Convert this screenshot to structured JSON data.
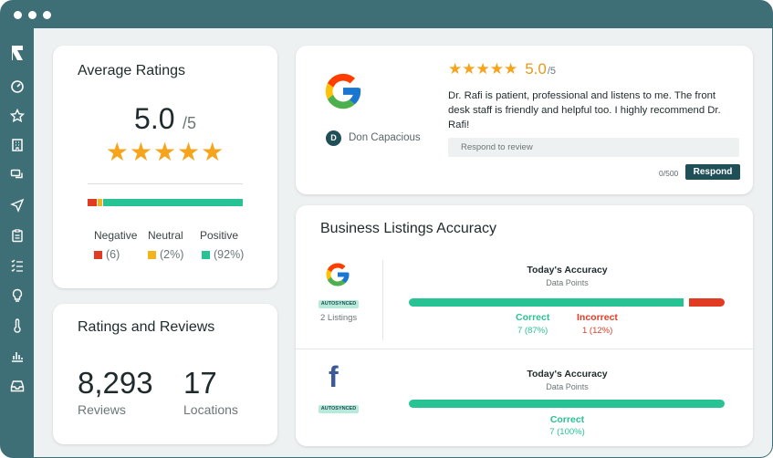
{
  "average_ratings": {
    "title": "Average Ratings",
    "score": "5.0",
    "out_of": "/5",
    "stars": "★★★★★",
    "bar_fractions": {
      "negative": 0.06,
      "neutral": 0.02,
      "positive": 0.92
    },
    "legend": [
      {
        "label": "Negative",
        "count": "(6)",
        "color": "#e23b24"
      },
      {
        "label": "Neutral",
        "count": "(2%)",
        "color": "#f2b31b"
      },
      {
        "label": "Positive",
        "count": "(92%)",
        "color": "#27c394"
      }
    ]
  },
  "ratings_reviews": {
    "title": "Ratings and Reviews",
    "reviews_count": "8,293",
    "reviews_label": "Reviews",
    "locations_count": "17",
    "locations_label": "Locations"
  },
  "review": {
    "stars": "★★★★★",
    "score": "5.0",
    "out_of": "/5",
    "text": "Dr. Rafi is patient, professional and listens to me. The front desk staff is friendly and helpful too. I highly recommend Dr. Rafi!",
    "reviewer_initial": "D",
    "reviewer_name": "Don Capacious",
    "respond_placeholder": "Respond to review",
    "char_count": "0/500",
    "respond_button": "Respond"
  },
  "listings": {
    "title": "Business Listings Accuracy",
    "google": {
      "badge": "AUTOSYNCED",
      "listings": "2 Listings",
      "accuracy_title": "Today's Accuracy",
      "data_points": "Data Points",
      "correct_label": "Correct",
      "correct_value": "7 (87%)",
      "incorrect_label": "Incorrect",
      "incorrect_value": "1 (12%)",
      "correct_fraction": 0.87
    },
    "facebook": {
      "badge": "AUTOSYNCED",
      "accuracy_title": "Today's Accuracy",
      "data_points": "Data Points",
      "correct_label": "Correct",
      "correct_value": "7 (100%)",
      "correct_fraction": 1.0
    }
  },
  "colors": {
    "sidebar": "#3f6f76",
    "green": "#27c394",
    "red": "#e23b24",
    "yellow": "#f2b31b",
    "star": "#f5a41c",
    "button": "#1f4f57"
  },
  "sidebar_icons": [
    "logo-icon",
    "dashboard-icon",
    "star-icon",
    "building-icon",
    "chat-icon",
    "send-icon",
    "clipboard-icon",
    "checklist-icon",
    "lightbulb-icon",
    "thermometer-icon",
    "bar-chart-icon",
    "inbox-icon"
  ]
}
